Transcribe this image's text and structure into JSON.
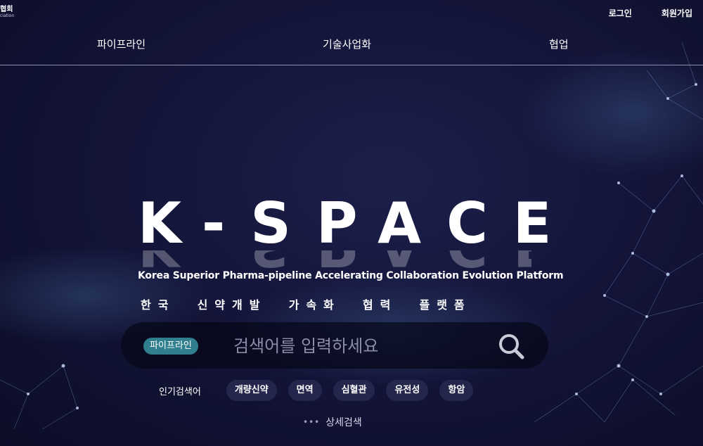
{
  "logo": {
    "line1": "협회",
    "line2": "ciation"
  },
  "top_links": [
    "로그인",
    "회원가입"
  ],
  "nav": {
    "items": [
      "파이프라인",
      "기술사업화",
      "협업"
    ]
  },
  "hero": {
    "title": "K-SPACE",
    "subtitle_en": "Korea Superior Pharma-pipeline Accelerating Collaboration Evolution Platform",
    "subtitle_ko": "한국  신약개발  가속화  협력  플랫폼"
  },
  "search": {
    "tag": "파이프라인",
    "placeholder": "검색어를 입력하세요",
    "value": ""
  },
  "popular": {
    "label": "인기검색어",
    "tags": [
      "개량신약",
      "면역",
      "심혈관",
      "유전성",
      "항암"
    ]
  },
  "detail_search": {
    "dots": "•••",
    "label": "상세검색"
  },
  "colors": {
    "accent": "#2f7f8e",
    "background": "#14153a"
  }
}
